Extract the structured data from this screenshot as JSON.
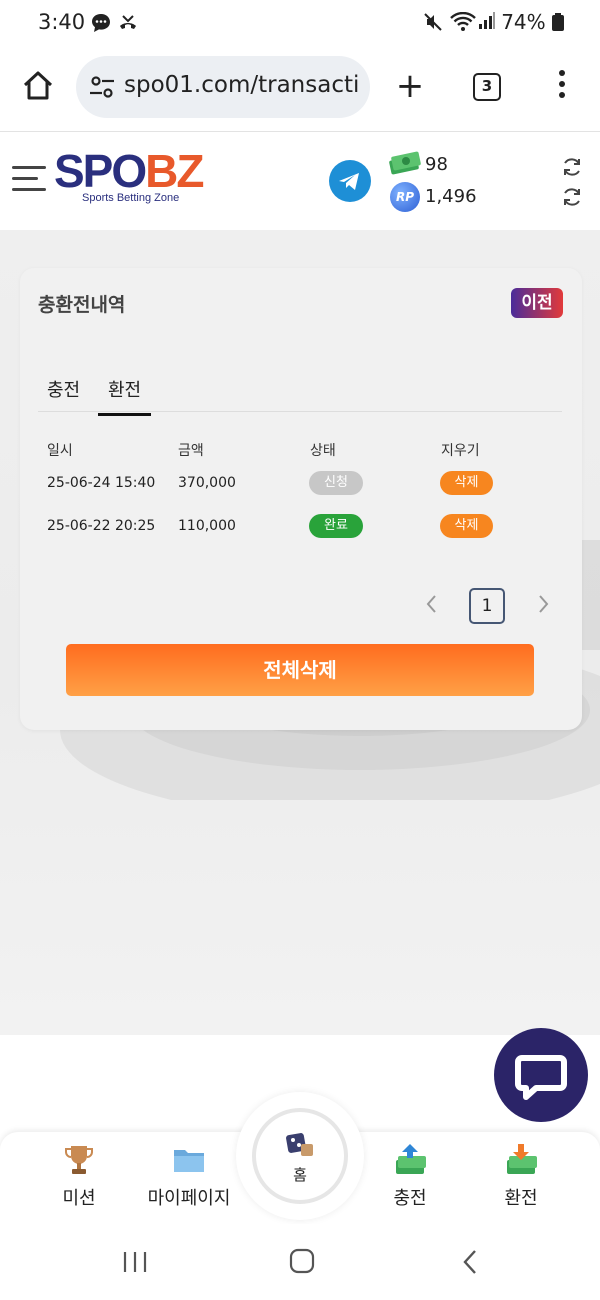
{
  "status": {
    "time": "3:40",
    "battery": "74%"
  },
  "browser": {
    "url": "spo01.com/transacti",
    "tab_count": "3"
  },
  "site": {
    "logo_main_a": "SPO",
    "logo_main_b": "BZ",
    "logo_tagline": "Sports Betting Zone",
    "money_value": "98",
    "rp_label": "RP",
    "rp_value": "1,496"
  },
  "panel": {
    "title": "충환전내역",
    "prev_label": "이전",
    "tabs": [
      {
        "label": "충전",
        "active": false
      },
      {
        "label": "환전",
        "active": true
      }
    ],
    "columns": [
      "일시",
      "금액",
      "상태",
      "지우기"
    ],
    "rows": [
      {
        "date": "25-06-24 15:40",
        "amount": "370,000",
        "status": "신청",
        "delete": "삭제"
      },
      {
        "date": "25-06-22 20:25",
        "amount": "110,000",
        "status": "완료",
        "delete": "삭제"
      }
    ],
    "page": "1",
    "delete_all": "전체삭제"
  },
  "bottom_nav": [
    {
      "label": "미션",
      "icon": "trophy-icon"
    },
    {
      "label": "마이페이지",
      "icon": "folder-icon"
    },
    {
      "label": "홈",
      "icon": "casino-home-icon"
    },
    {
      "label": "충전",
      "icon": "deposit-money-icon"
    },
    {
      "label": "환전",
      "icon": "withdraw-money-icon"
    }
  ],
  "colors": {
    "brand_navy": "#2a2f7e",
    "brand_orange": "#e8592b",
    "status_done": "#29a33a",
    "delete_orange": "#f7861f",
    "chat_bg": "#2b2468"
  }
}
